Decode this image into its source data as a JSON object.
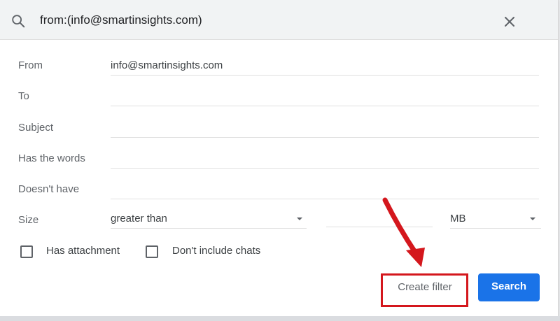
{
  "search": {
    "query": "from:(info@smartinsights.com)",
    "icon": "search-icon",
    "close_icon": "close-icon"
  },
  "fields": [
    {
      "label": "From",
      "value": "info@smartinsights.com"
    },
    {
      "label": "To",
      "value": ""
    },
    {
      "label": "Subject",
      "value": ""
    },
    {
      "label": "Has the words",
      "value": ""
    },
    {
      "label": "Doesn't have",
      "value": ""
    }
  ],
  "size": {
    "label": "Size",
    "operator": "greater than",
    "value": "",
    "unit": "MB"
  },
  "checkboxes": {
    "has_attachment": {
      "label": "Has attachment",
      "checked": false
    },
    "dont_include_chats": {
      "label": "Don't include chats",
      "checked": false
    }
  },
  "buttons": {
    "create_filter": "Create filter",
    "search": "Search"
  },
  "colors": {
    "accent": "#1a73e8",
    "highlight": "#d4171d"
  }
}
